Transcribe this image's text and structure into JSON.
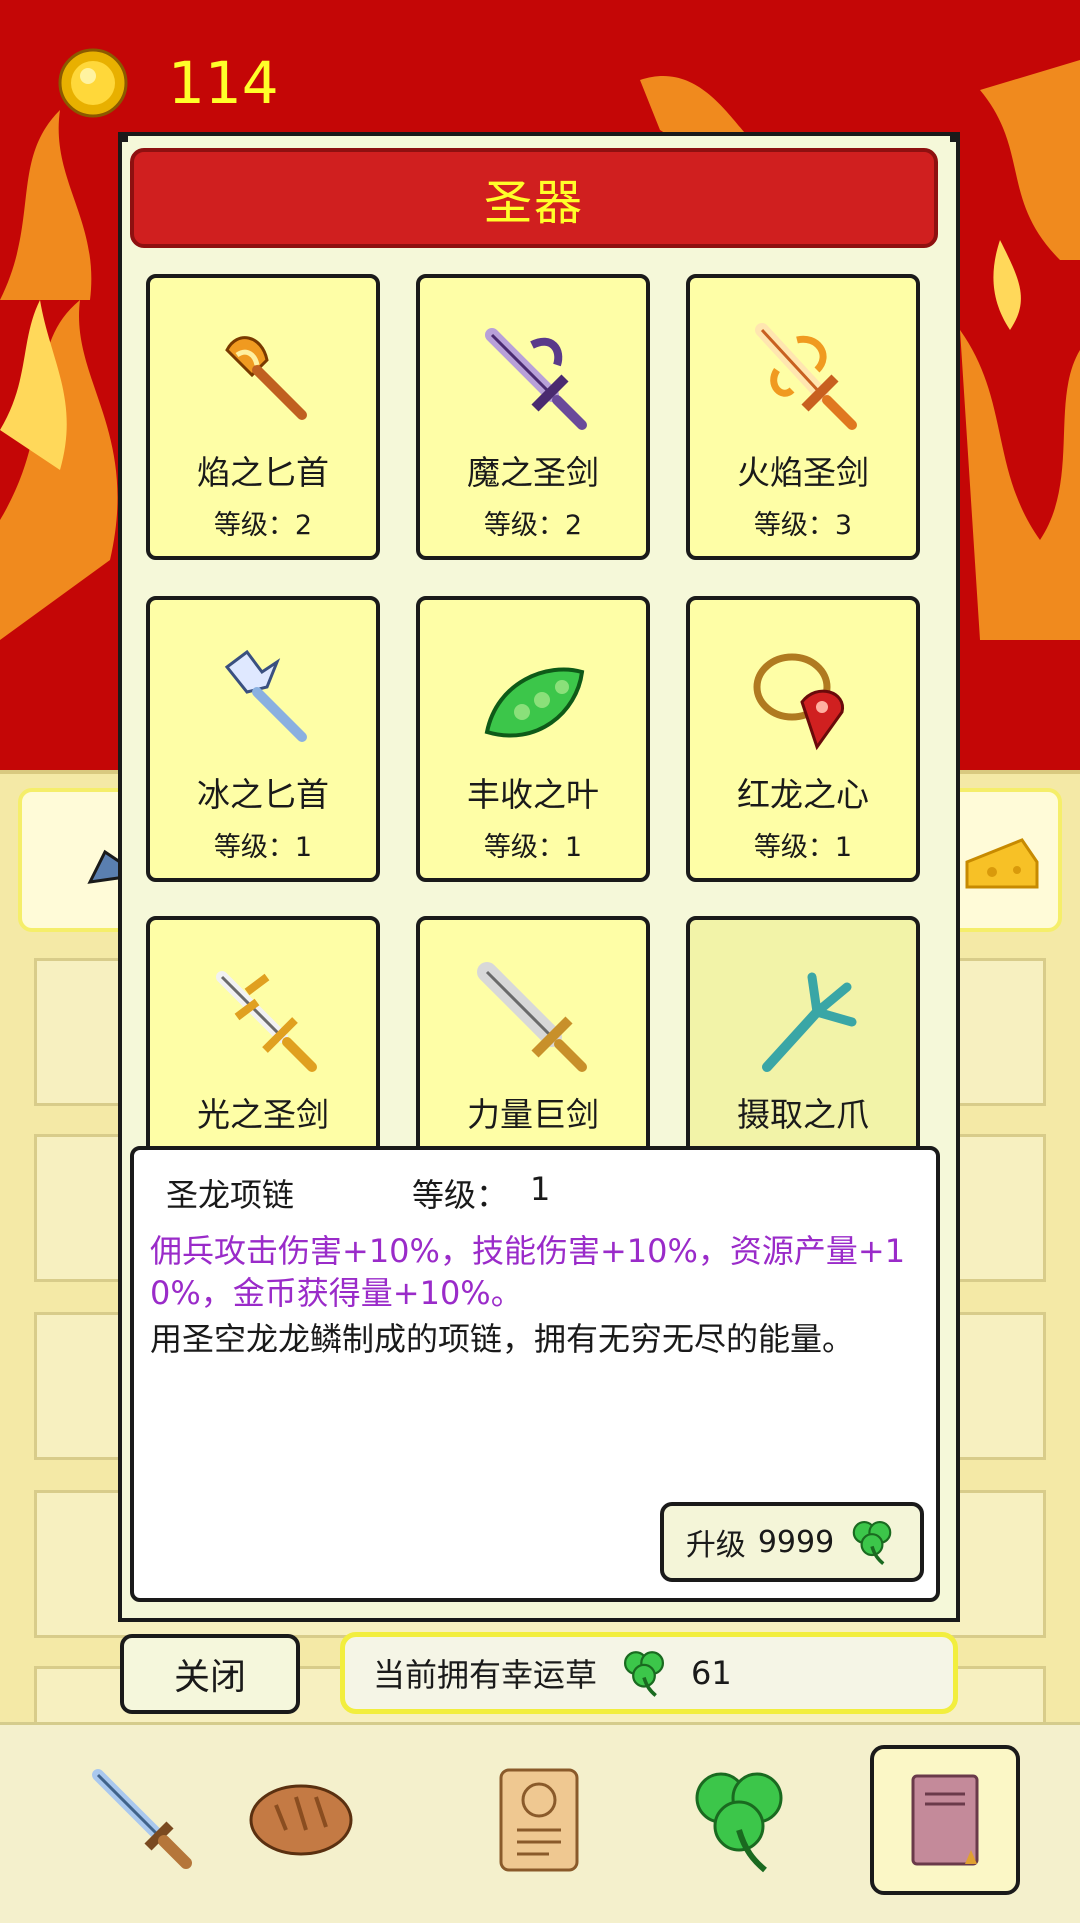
{
  "colors": {
    "background": "#c40606",
    "flame": "#f08a1e",
    "banner": "#d01f1f",
    "banner_text": "#ffff2a",
    "card": "#fefea6",
    "effect_text": "#9a2bc9",
    "coin_text": "#ffff2a"
  },
  "currency": {
    "icon": "gold-coin-icon",
    "value": "114"
  },
  "dialog": {
    "title": "圣器",
    "level_prefix": "等级：",
    "items": [
      {
        "name": "焰之匕首",
        "level": "2",
        "icon": "fire-dagger-icon"
      },
      {
        "name": "魔之圣剑",
        "level": "2",
        "icon": "demon-sword-icon"
      },
      {
        "name": "火焰圣剑",
        "level": "3",
        "icon": "flame-sword-icon"
      },
      {
        "name": "冰之匕首",
        "level": "1",
        "icon": "ice-dagger-icon"
      },
      {
        "name": "丰收之叶",
        "level": "1",
        "icon": "harvest-leaf-icon"
      },
      {
        "name": "红龙之心",
        "level": "1",
        "icon": "red-dragon-heart-icon"
      },
      {
        "name": "光之圣剑",
        "level": "",
        "icon": "light-sword-icon"
      },
      {
        "name": "力量巨剑",
        "level": "",
        "icon": "power-greatsword-icon"
      },
      {
        "name": "摄取之爪",
        "level": "",
        "icon": "grasping-claw-icon"
      }
    ],
    "detail": {
      "name": "圣龙项链",
      "level_label": "等级：",
      "level_value": "1",
      "effect": "佣兵攻击伤害+10%，技能伤害+10%，资源产量+10%，金币获得量+10%。",
      "description": "用圣空龙龙鳞制成的项链，拥有无穷无尽的能量。",
      "upgrade_label": "升级",
      "upgrade_cost": "9999",
      "upgrade_icon": "clover-icon"
    }
  },
  "footer": {
    "close_label": "关闭",
    "clover_label": "当前拥有幸运草",
    "clover_icon": "clover-icon",
    "clover_count": "61"
  },
  "tabs": [
    {
      "icon": "sword-icon",
      "active": false
    },
    {
      "icon": "bread-icon",
      "active": false
    },
    {
      "icon": "scroll-icon",
      "active": false
    },
    {
      "icon": "clover-icon",
      "active": false
    },
    {
      "icon": "book-icon",
      "active": true
    }
  ]
}
